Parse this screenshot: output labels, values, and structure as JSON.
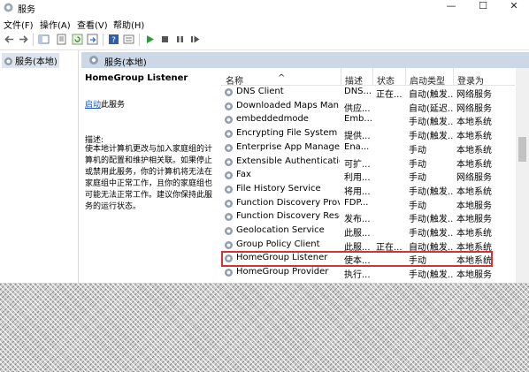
{
  "window": {
    "title": "服务",
    "icon": "services-gear-icon",
    "controls": [
      "—",
      "☐",
      "✕"
    ]
  },
  "menu": [
    "文件(F)",
    "操作(A)",
    "查看(V)",
    "帮助(H)"
  ],
  "toolbar_icons": [
    "back-arrow-icon",
    "forward-arrow-icon",
    "console-tree-icon",
    "properties-icon",
    "refresh-icon",
    "export-icon",
    "help-icon",
    "view-icon",
    "start-service-icon",
    "stop-service-icon",
    "pause-service-icon",
    "restart-service-icon"
  ],
  "tree": {
    "root_label": "服务(本地)"
  },
  "pane": {
    "header": "服务(本地)"
  },
  "detail": {
    "service_name": "HomeGroup Listener",
    "start_link": "启动",
    "start_suffix": "此服务",
    "description_label": "描述:",
    "description": "使本地计算机更改与加入家庭组的计算机的配置和维护相关联。如果停止或禁用此服务，你的计算机将无法在家庭组中正常工作，且你的家庭组也可能无法正常工作。建议你保持此服务的运行状态。"
  },
  "columns": [
    "名称",
    "描述",
    "状态",
    "启动类型",
    "登录为"
  ],
  "services": [
    {
      "name": "DNS Client",
      "desc": "DNS...",
      "state": "正在...",
      "startup": "自动(触发...",
      "logon": "网络服务"
    },
    {
      "name": "Downloaded Maps Man...",
      "desc": "供应...",
      "state": "",
      "startup": "自动(延迟...",
      "logon": "网络服务"
    },
    {
      "name": "embeddedmode",
      "desc": "Emb...",
      "state": "",
      "startup": "手动(触发...",
      "logon": "本地系统"
    },
    {
      "name": "Encrypting File System (E...",
      "desc": "提供...",
      "state": "",
      "startup": "手动(触发...",
      "logon": "本地系统"
    },
    {
      "name": "Enterprise App Manage...",
      "desc": "Ena...",
      "state": "",
      "startup": "手动",
      "logon": "本地系统"
    },
    {
      "name": "Extensible Authentication...",
      "desc": "可扩...",
      "state": "",
      "startup": "手动",
      "logon": "本地系统"
    },
    {
      "name": "Fax",
      "desc": "利用...",
      "state": "",
      "startup": "手动",
      "logon": "网络服务"
    },
    {
      "name": "File History Service",
      "desc": "将用...",
      "state": "",
      "startup": "手动(触发...",
      "logon": "本地系统"
    },
    {
      "name": "Function Discovery Provi...",
      "desc": "FDP...",
      "state": "",
      "startup": "手动",
      "logon": "本地服务"
    },
    {
      "name": "Function Discovery Reso...",
      "desc": "发布...",
      "state": "",
      "startup": "手动(触发...",
      "logon": "本地服务"
    },
    {
      "name": "Geolocation Service",
      "desc": "此服...",
      "state": "",
      "startup": "手动(触发...",
      "logon": "本地系统"
    },
    {
      "name": "Group Policy Client",
      "desc": "此服...",
      "state": "正在...",
      "startup": "自动(触发...",
      "logon": "本地系统"
    },
    {
      "name": "HomeGroup Listener",
      "desc": "使本...",
      "state": "",
      "startup": "手动",
      "logon": "本地系统"
    },
    {
      "name": "HomeGroup Provider",
      "desc": "执行...",
      "state": "",
      "startup": "手动(触发...",
      "logon": "本地服务"
    }
  ],
  "highlight_color": "#d33333"
}
